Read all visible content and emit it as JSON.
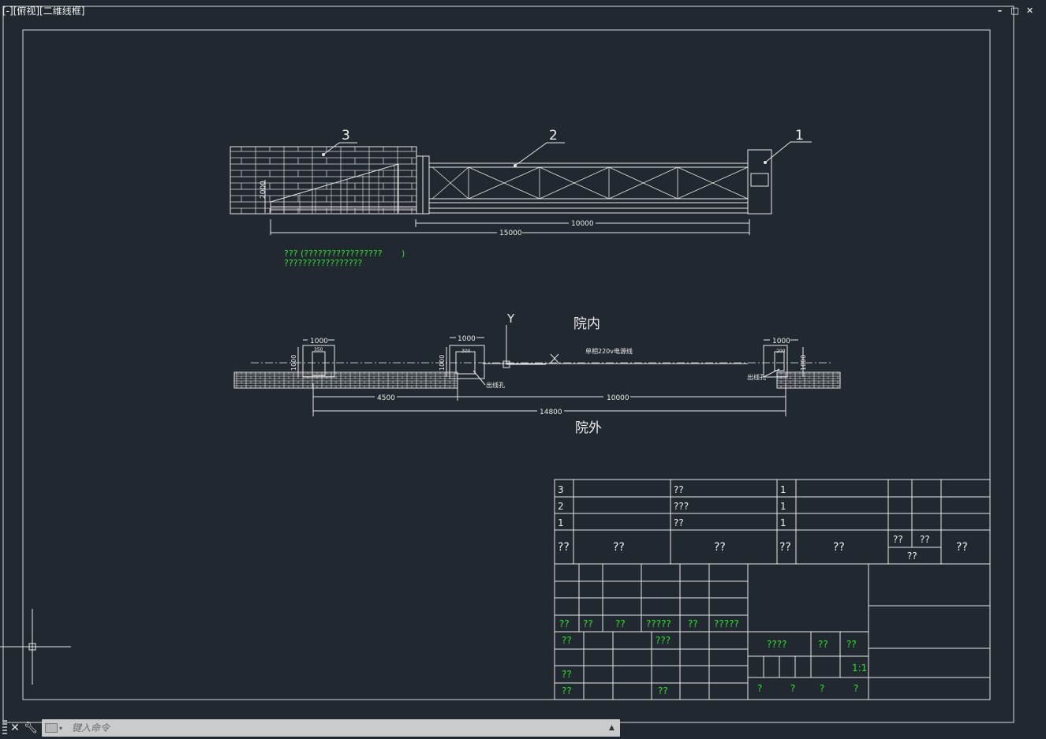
{
  "viewport": {
    "label": "[-][俯视][二维线框]"
  },
  "window_controls": {
    "minimize": "–",
    "restore": "□",
    "close": "✕"
  },
  "elevation": {
    "callouts": [
      "3",
      "2",
      "1"
    ],
    "dims": {
      "height": "2000",
      "span_10000": "10000",
      "span_15000": "15000"
    },
    "note_lines": [
      "??? (?????????????????",
      ")",
      "?????????????????"
    ]
  },
  "plan": {
    "label_inside": "院内",
    "label_outside": "院外",
    "axis_y": "Y",
    "axis_x": "X",
    "cable_label": "单相220v电源线",
    "hole_label_left": "出线孔",
    "hole_label_right": "出线孔",
    "dims": {
      "w1000_a": "1000",
      "w1000_b": "1000",
      "w1000_c": "1000",
      "h1000_a": "1000",
      "h1000_b": "1000",
      "h1000_c": "1000",
      "small_a": "350",
      "small_b": "300",
      "small_c": "200",
      "d4500": "4500",
      "d10000": "10000",
      "d14800": "14800"
    }
  },
  "title_block": {
    "parts_rows": [
      {
        "no": "3",
        "name": "??",
        "qty": "1"
      },
      {
        "no": "2",
        "name": "???",
        "qty": "1"
      },
      {
        "no": "1",
        "name": "??",
        "qty": "1"
      }
    ],
    "header": {
      "c1": "??",
      "c2": "??",
      "c3": "??",
      "c4": "??",
      "c5": "??",
      "c6a": "??",
      "c6b": "??",
      "c6c": "??",
      "c7": "??"
    },
    "rev_row": [
      "??",
      "??",
      "??",
      "?????",
      "??",
      "?????"
    ],
    "sign": {
      "design": "???",
      "r1": "??",
      "r2": "??",
      "r3": "??",
      "r4": "??"
    },
    "stage": {
      "a": "????",
      "b": "??",
      "c": "??"
    },
    "scale": "1:1",
    "sheet": [
      "?",
      "?",
      "?",
      "?"
    ]
  },
  "command": {
    "placeholder": "键入命令"
  }
}
